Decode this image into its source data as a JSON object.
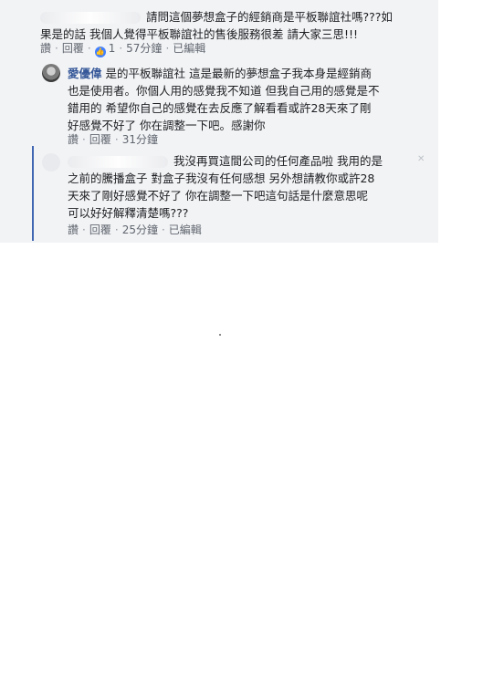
{
  "comment1": {
    "text_line1": "請問這個夢想盒子的經銷商是平板聯誼社嗎???如",
    "text_line2": "果是的話 我個人覺得平板聯誼社的售後服務很差 請大家三思!!!",
    "like_label": "讚",
    "reply_label": "回覆",
    "like_count": "1",
    "time": "57分鐘",
    "edited": "已編輯"
  },
  "reply1": {
    "author": "愛優偉",
    "text_line1": "是的平板聯誼社 這是最新的夢想盒子我本身是經銷商",
    "text_line2": "也是使用者。你個人用的感覺我不知道 但我自己用的感覺是不",
    "text_line3": "錯用的 希望你自己的感覺在去反應了解看看或許28天來了剛",
    "text_line4": "好感覺不好了 你在調整一下吧。感謝你",
    "like_label": "讚",
    "reply_label": "回覆",
    "time": "31分鐘"
  },
  "reply2": {
    "text_line1": "我沒再買這間公司的任何產品啦 我用的是",
    "text_line2": "之前的騰播盒子 對盒子我沒有任何感想 另外想請教你或許28",
    "text_line3": "天來了剛好感覺不好了 你在調整一下吧這句話是什麼意思呢",
    "text_line4": "可以好好解釋清楚嗎???",
    "like_label": "讚",
    "reply_label": "回覆",
    "time": "25分鐘",
    "edited": "已編輯"
  },
  "icons": {
    "like_badge": "thumbs-up-icon",
    "remove": "close-icon"
  },
  "colors": {
    "panel": "#f2f3f5",
    "link": "#365899",
    "thread": "#4267b2",
    "like": "#4080ff"
  }
}
